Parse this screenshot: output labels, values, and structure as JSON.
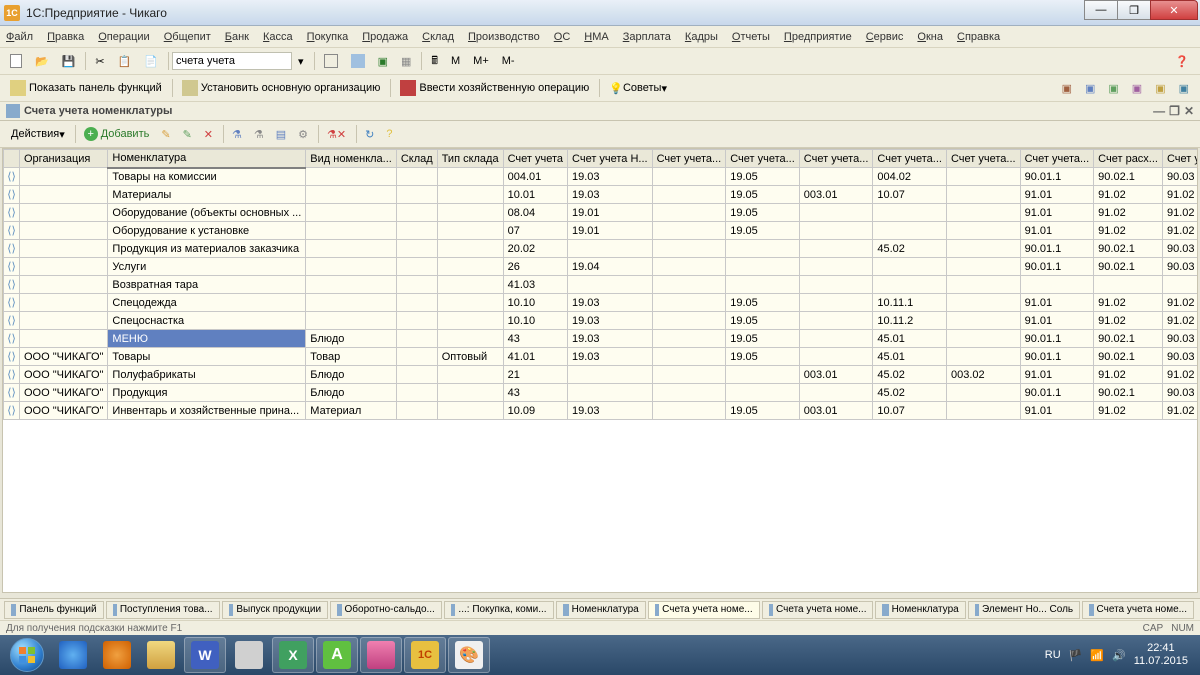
{
  "window": {
    "title": "1С:Предприятие - Чикаго"
  },
  "menu": [
    "Файл",
    "Правка",
    "Операции",
    "Общепит",
    "Банк",
    "Касса",
    "Покупка",
    "Продажа",
    "Склад",
    "Производство",
    "ОС",
    "НМА",
    "Зарплата",
    "Кадры",
    "Отчеты",
    "Предприятие",
    "Сервис",
    "Окна",
    "Справка"
  ],
  "toolbar1": {
    "search": "счета учета",
    "m": "M",
    "mplus": "M+",
    "mminus": "M-"
  },
  "toolbar2": {
    "show_panel": "Показать панель функций",
    "set_org": "Установить основную организацию",
    "enter_op": "Ввести хозяйственную операцию",
    "tips": "Советы"
  },
  "doc_tab": {
    "title": "Счета учета номенклатуры",
    "restore": "❐",
    "close": "✕",
    "min": "—"
  },
  "actions": {
    "label": "Действия",
    "add": "Добавить"
  },
  "grid": {
    "columns": [
      "",
      "Организация",
      "Номенклатура",
      "Вид номенкла...",
      "Склад",
      "Тип склада",
      "Счет учета",
      "Счет учета Н...",
      "Счет учета...",
      "Счет учета...",
      "Счет учета...",
      "Счет учета...",
      "Счет учета...",
      "Счет учета...",
      "Счет расх...",
      "Счет учет..."
    ],
    "rows": [
      {
        "org": "",
        "nom": "Товары на комиссии",
        "vid": "",
        "skl": "",
        "tip": "",
        "c": [
          "004.01",
          "19.03",
          "",
          "19.05",
          "",
          "004.02",
          "",
          "90.01.1",
          "90.02.1",
          "90.03"
        ]
      },
      {
        "org": "",
        "nom": "Материалы",
        "vid": "",
        "skl": "",
        "tip": "",
        "c": [
          "10.01",
          "19.03",
          "",
          "19.05",
          "003.01",
          "10.07",
          "",
          "91.01",
          "91.02",
          "91.02"
        ]
      },
      {
        "org": "",
        "nom": "Оборудование (объекты основных ...",
        "vid": "",
        "skl": "",
        "tip": "",
        "c": [
          "08.04",
          "19.01",
          "",
          "19.05",
          "",
          "",
          "",
          "91.01",
          "91.02",
          "91.02"
        ]
      },
      {
        "org": "",
        "nom": "Оборудование к установке",
        "vid": "",
        "skl": "",
        "tip": "",
        "c": [
          "07",
          "19.01",
          "",
          "19.05",
          "",
          "",
          "",
          "91.01",
          "91.02",
          "91.02"
        ]
      },
      {
        "org": "",
        "nom": "Продукция из материалов заказчика",
        "vid": "",
        "skl": "",
        "tip": "",
        "c": [
          "20.02",
          "",
          "",
          "",
          "",
          "45.02",
          "",
          "90.01.1",
          "90.02.1",
          "90.03"
        ]
      },
      {
        "org": "",
        "nom": "Услуги",
        "vid": "",
        "skl": "",
        "tip": "",
        "c": [
          "26",
          "19.04",
          "",
          "",
          "",
          "",
          "",
          "90.01.1",
          "90.02.1",
          "90.03"
        ]
      },
      {
        "org": "",
        "nom": "Возвратная тара",
        "vid": "",
        "skl": "",
        "tip": "",
        "c": [
          "41.03",
          "",
          "",
          "",
          "",
          "",
          "",
          "",
          "",
          ""
        ]
      },
      {
        "org": "",
        "nom": "Спецодежда",
        "vid": "",
        "skl": "",
        "tip": "",
        "c": [
          "10.10",
          "19.03",
          "",
          "19.05",
          "",
          "10.11.1",
          "",
          "91.01",
          "91.02",
          "91.02"
        ]
      },
      {
        "org": "",
        "nom": "Спецоснастка",
        "vid": "",
        "skl": "",
        "tip": "",
        "c": [
          "10.10",
          "19.03",
          "",
          "19.05",
          "",
          "10.11.2",
          "",
          "91.01",
          "91.02",
          "91.02"
        ]
      },
      {
        "org": "",
        "nom": "МЕНЮ",
        "vid": "Блюдо",
        "skl": "",
        "tip": "",
        "c": [
          "43",
          "19.03",
          "",
          "19.05",
          "",
          "45.01",
          "",
          "90.01.1",
          "90.02.1",
          "90.03"
        ],
        "selected": true
      },
      {
        "org": "ООО \"ЧИКАГО\"",
        "nom": "Товары",
        "vid": "Товар",
        "skl": "",
        "tip": "Оптовый",
        "c": [
          "41.01",
          "19.03",
          "",
          "19.05",
          "",
          "45.01",
          "",
          "90.01.1",
          "90.02.1",
          "90.03"
        ]
      },
      {
        "org": "ООО \"ЧИКАГО\"",
        "nom": "Полуфабрикаты",
        "vid": "Блюдо",
        "skl": "",
        "tip": "",
        "c": [
          "21",
          "",
          "",
          "",
          "003.01",
          "45.02",
          "003.02",
          "91.01",
          "91.02",
          "91.02"
        ]
      },
      {
        "org": "ООО \"ЧИКАГО\"",
        "nom": "Продукция",
        "vid": "Блюдо",
        "skl": "",
        "tip": "",
        "c": [
          "43",
          "",
          "",
          "",
          "",
          "45.02",
          "",
          "90.01.1",
          "90.02.1",
          "90.03"
        ]
      },
      {
        "org": "ООО \"ЧИКАГО\"",
        "nom": "Инвентарь и хозяйственные прина...",
        "vid": "Материал",
        "skl": "",
        "tip": "",
        "c": [
          "10.09",
          "19.03",
          "",
          "19.05",
          "003.01",
          "10.07",
          "",
          "91.01",
          "91.02",
          "91.02"
        ]
      }
    ]
  },
  "bottom_tabs": [
    "Панель функций",
    "Поступления това...",
    "Выпуск продукции",
    "Оборотно-сальдо...",
    "...: Покупка, коми...",
    "Номенклатура",
    "Счета учета номе...",
    "Счета учета номе...",
    "Номенклатура",
    "Элемент Но...  Соль",
    "Счета учета номе..."
  ],
  "status": {
    "hint": "Для получения подсказки нажмите F1",
    "cap": "CAP",
    "num": "NUM"
  },
  "taskbar": {
    "lang": "RU",
    "time": "22:41",
    "date": "11.07.2015"
  }
}
